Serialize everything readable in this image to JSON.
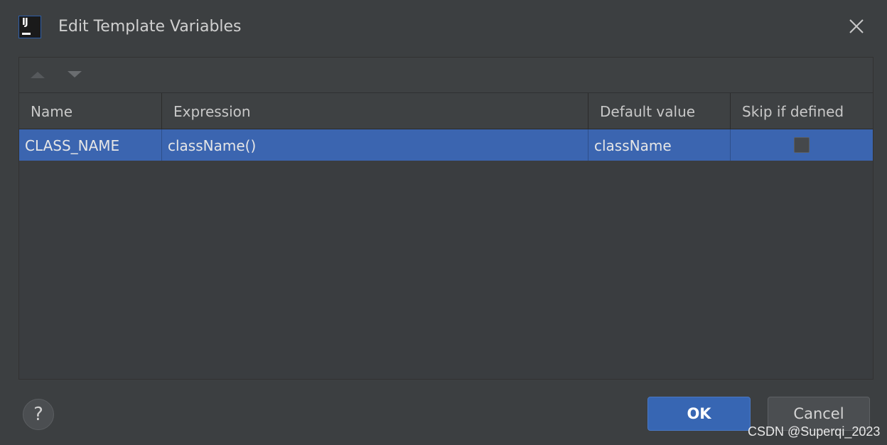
{
  "window": {
    "title": "Edit Template Variables",
    "app_logo_text": "IJ",
    "app_icon": "intellij-icon",
    "close_icon": "close-icon"
  },
  "toolbar": {
    "move_up_icon": "arrow-up-icon",
    "move_down_icon": "arrow-down-icon"
  },
  "table": {
    "columns": [
      "Name",
      "Expression",
      "Default value",
      "Skip if defined"
    ],
    "rows": [
      {
        "name": "CLASS_NAME",
        "expression": "className()",
        "default_value": "className",
        "skip_if_defined": false
      }
    ],
    "selected_row": 0
  },
  "buttons": {
    "help_label": "?",
    "ok_label": "OK",
    "cancel_label": "Cancel"
  },
  "watermark": "CSDN @Superqi_2023",
  "colors": {
    "background": "#3c3f41",
    "selection": "#3b65b0",
    "ok_button": "#3766b3",
    "text": "#d0d0d0"
  }
}
